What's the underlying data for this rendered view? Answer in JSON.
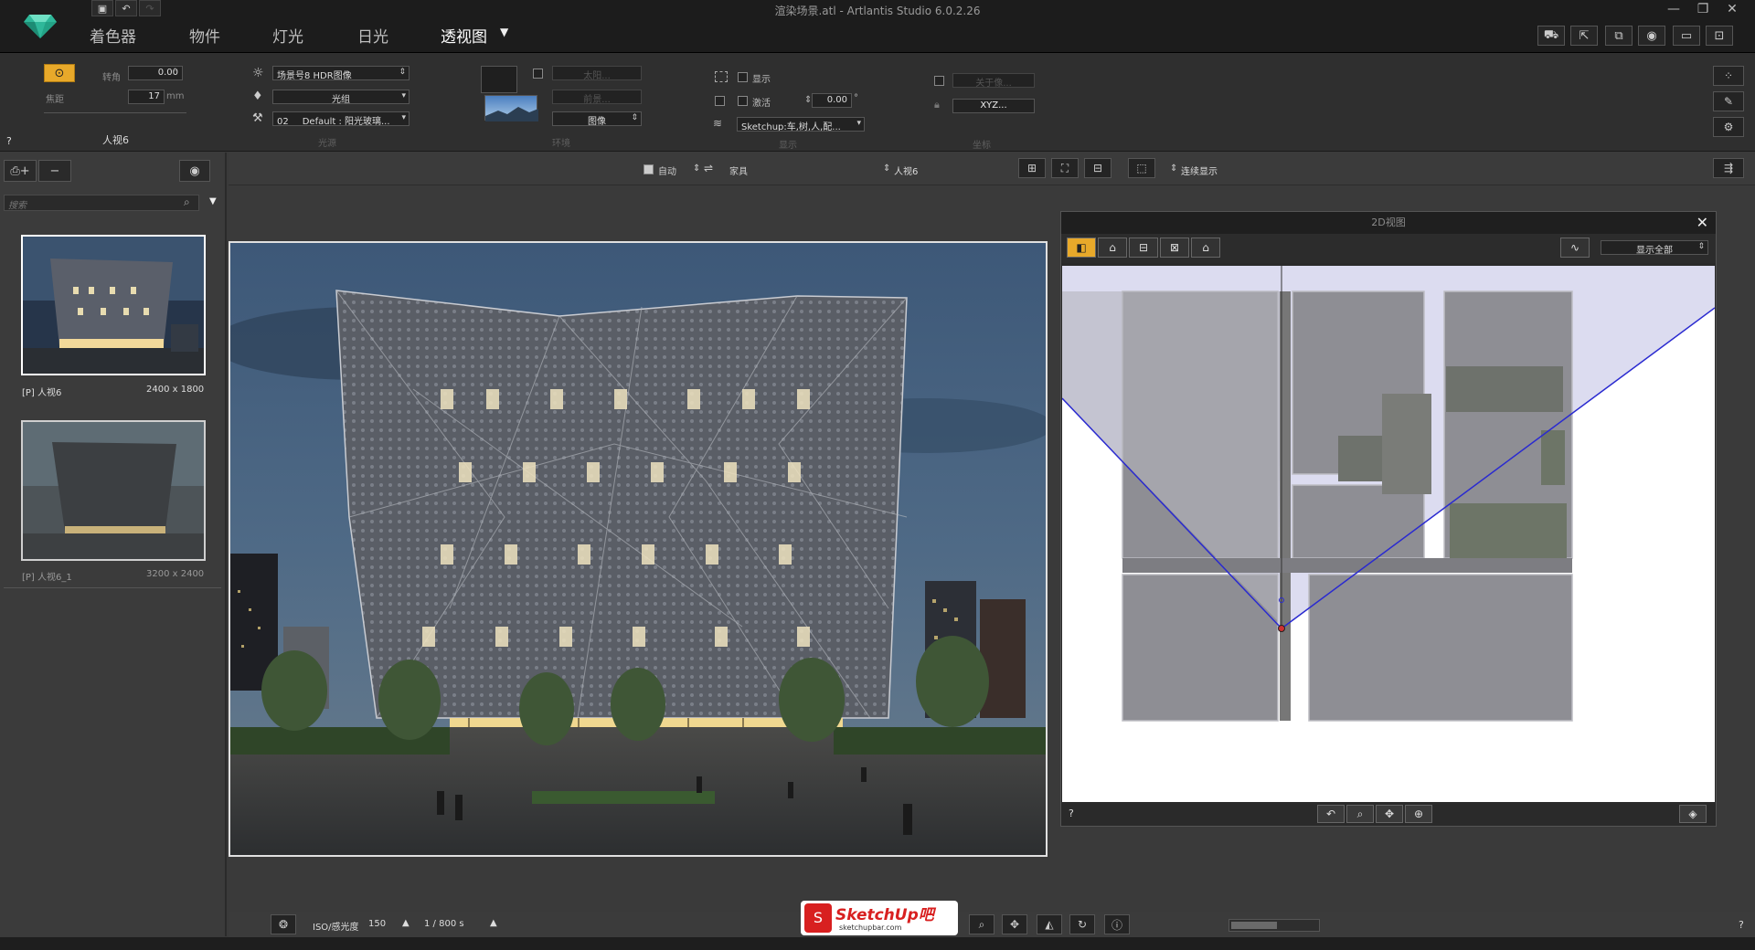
{
  "window": {
    "title": "渲染场景.atl - Artlantis Studio 6.0.2.26"
  },
  "main_menu": [
    {
      "label": "着色器"
    },
    {
      "label": "物件"
    },
    {
      "label": "灯光"
    },
    {
      "label": "日光"
    },
    {
      "label": "透视图"
    }
  ],
  "ribbon": {
    "camera": {
      "roll_label": "转角",
      "roll_value": "0.00",
      "roll_unit": "°",
      "focal_label": "焦距",
      "focal_value": "17",
      "focal_unit": "mm",
      "view_name": "人视6",
      "help": "?"
    },
    "background": {
      "env_select": "场景号8 HDR图像",
      "light_select": "光组",
      "shader_select": "02___Default : 阳光玻璃...",
      "group_label": "光源"
    },
    "foreground": {
      "field1": "太阳...",
      "field2": "前景...",
      "image_select": "图像",
      "group_label": "环境"
    },
    "display": {
      "show_label": "显示",
      "activate_label": "激活",
      "angle_value": "0.00",
      "angle_unit": "°",
      "layer_select": "Sketchup:车,树,人,配...",
      "group_label": "显示"
    },
    "coords": {
      "field1": "关于像...",
      "xyz_button": "XYZ...",
      "group_label": "坐标"
    }
  },
  "left_panel": {
    "search_placeholder": "搜索",
    "views": [
      {
        "name": "[P] 人视6",
        "size": "2400 x 1800"
      },
      {
        "name": "[P] 人视6_1",
        "size": "3200 x 2400"
      }
    ]
  },
  "view_toolbar": {
    "auto_label": "自动",
    "furniture_label": "家具",
    "view_select": "人视6",
    "render_mode": "连续显示"
  },
  "view2d": {
    "title": "2D视图",
    "show_all": "显示全部",
    "help": "?"
  },
  "bottom": {
    "iso_label": "ISO/感光度",
    "iso_value": "150",
    "shutter_value": "1 / 800 s",
    "help": "?"
  },
  "watermark": {
    "brand": "SketchUp吧",
    "url": "sketchupbar.com"
  }
}
